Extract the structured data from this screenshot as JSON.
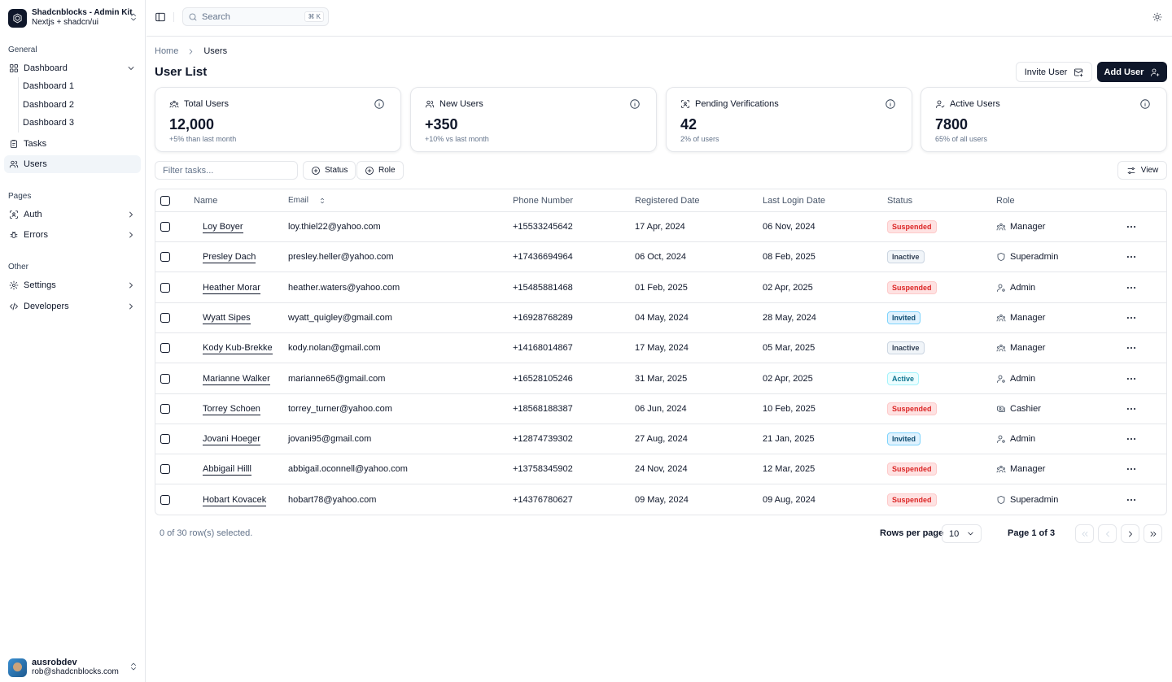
{
  "brand": {
    "title": "Shadcnblocks - Admin Kit",
    "subtitle": "Nextjs + shadcn/ui"
  },
  "sidebar": {
    "general_label": "General",
    "pages_label": "Pages",
    "other_label": "Other",
    "dashboard": "Dashboard",
    "dashboard_subs": [
      "Dashboard 1",
      "Dashboard 2",
      "Dashboard 3"
    ],
    "tasks": "Tasks",
    "users": "Users",
    "auth": "Auth",
    "errors": "Errors",
    "settings": "Settings",
    "developers": "Developers"
  },
  "account": {
    "name": "ausrobdev",
    "email": "rob@shadcnblocks.com"
  },
  "topbar": {
    "search_placeholder": "Search",
    "search_shortcut": "⌘ K"
  },
  "breadcrumb": {
    "home": "Home",
    "current": "Users"
  },
  "page": {
    "title": "User List",
    "invite_label": "Invite User",
    "add_label": "Add User"
  },
  "stats": [
    {
      "label": "Total Users",
      "value": "12,000",
      "note": "+5% than last month"
    },
    {
      "label": "New Users",
      "value": "+350",
      "note": "+10% vs last month"
    },
    {
      "label": "Pending Verifications",
      "value": "42",
      "note": "2% of users"
    },
    {
      "label": "Active Users",
      "value": "7800",
      "note": "65% of all users"
    }
  ],
  "toolbar": {
    "filter_placeholder": "Filter tasks...",
    "status_label": "Status",
    "role_label": "Role",
    "view_label": "View"
  },
  "table": {
    "columns": {
      "name": "Name",
      "email": "Email",
      "phone": "Phone Number",
      "registered": "Registered Date",
      "last_login": "Last Login Date",
      "status": "Status",
      "role": "Role"
    },
    "rows": [
      {
        "name": "Loy Boyer",
        "email": "loy.thiel22@yahoo.com",
        "phone": "+15533245642",
        "registered": "17 Apr, 2024",
        "last_login": "06 Nov, 2024",
        "status": "Suspended",
        "role": "Manager"
      },
      {
        "name": "Presley Dach",
        "email": "presley.heller@yahoo.com",
        "phone": "+17436694964",
        "registered": "06 Oct, 2024",
        "last_login": "08 Feb, 2025",
        "status": "Inactive",
        "role": "Superadmin"
      },
      {
        "name": "Heather Morar",
        "email": "heather.waters@yahoo.com",
        "phone": "+15485881468",
        "registered": "01 Feb, 2025",
        "last_login": "02 Apr, 2025",
        "status": "Suspended",
        "role": "Admin"
      },
      {
        "name": "Wyatt Sipes",
        "email": "wyatt_quigley@gmail.com",
        "phone": "+16928768289",
        "registered": "04 May, 2024",
        "last_login": "28 May, 2024",
        "status": "Invited",
        "role": "Manager"
      },
      {
        "name": "Kody Kub-Brekke",
        "email": "kody.nolan@gmail.com",
        "phone": "+14168014867",
        "registered": "17 May, 2024",
        "last_login": "05 Mar, 2025",
        "status": "Inactive",
        "role": "Manager"
      },
      {
        "name": "Marianne Walker",
        "email": "marianne65@gmail.com",
        "phone": "+16528105246",
        "registered": "31 Mar, 2025",
        "last_login": "02 Apr, 2025",
        "status": "Active",
        "role": "Admin"
      },
      {
        "name": "Torrey Schoen",
        "email": "torrey_turner@yahoo.com",
        "phone": "+18568188387",
        "registered": "06 Jun, 2024",
        "last_login": "10 Feb, 2025",
        "status": "Suspended",
        "role": "Cashier"
      },
      {
        "name": "Jovani Hoeger",
        "email": "jovani95@gmail.com",
        "phone": "+12874739302",
        "registered": "27 Aug, 2024",
        "last_login": "21 Jan, 2025",
        "status": "Invited",
        "role": "Admin"
      },
      {
        "name": "Abbigail Hilll",
        "email": "abbigail.oconnell@yahoo.com",
        "phone": "+13758345902",
        "registered": "24 Nov, 2024",
        "last_login": "12 Mar, 2025",
        "status": "Suspended",
        "role": "Manager"
      },
      {
        "name": "Hobart Kovacek",
        "email": "hobart78@yahoo.com",
        "phone": "+14376780627",
        "registered": "09 May, 2024",
        "last_login": "09 Aug, 2024",
        "status": "Suspended",
        "role": "Superadmin"
      }
    ]
  },
  "pagination": {
    "selected_text": "0 of 30 row(s) selected.",
    "rows_per_page_label": "Rows per page",
    "rows_per_page": "10",
    "page_text": "Page 1 of 3"
  },
  "colors": {
    "primary": "#0f172a",
    "suspended": "#dc2626",
    "invited": "#0284c7",
    "active": "#0e7490",
    "border": "#e5e7eb"
  }
}
